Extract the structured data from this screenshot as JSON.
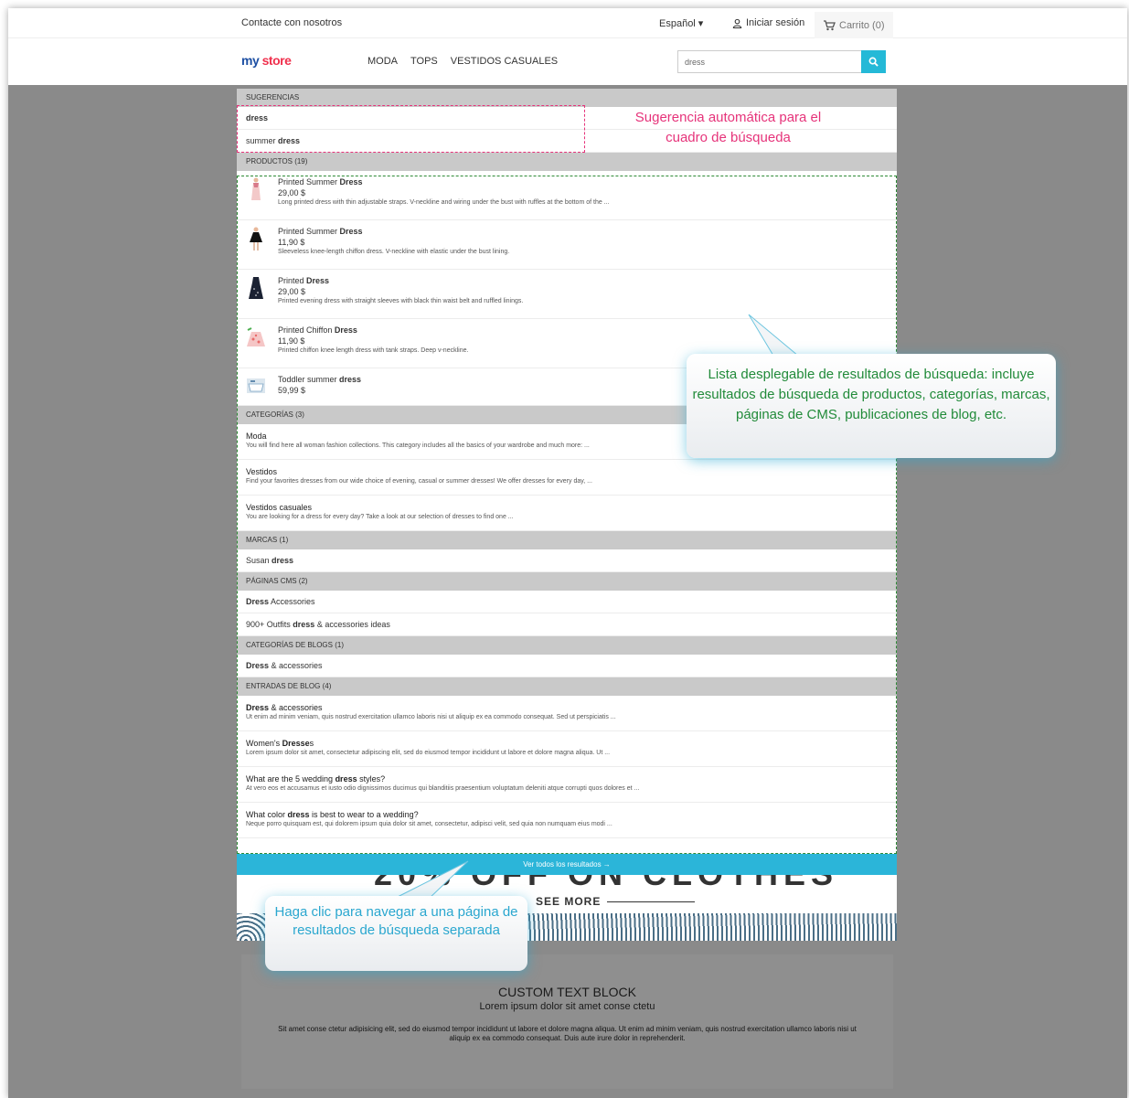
{
  "topbar": {
    "contact": "Contacte con nosotros",
    "language": "Español ▾",
    "login": "Iniciar sesión",
    "cart": "Carrito (0)"
  },
  "header": {
    "logo_part1": "my",
    "logo_part2": "store",
    "nav": [
      "MODA",
      "TOPS",
      "VESTIDOS CASUALES"
    ],
    "search_value": "dress"
  },
  "dropdown": {
    "suggestions_title": "SUGERENCIAS",
    "suggestions": [
      {
        "pre": "",
        "bold": "dress"
      },
      {
        "pre": "summer ",
        "bold": "dress"
      }
    ],
    "products_title": "PRODUCTOS (19)",
    "products": [
      {
        "pre": "Printed Summer ",
        "bold": "Dress",
        "price": "29,00 $",
        "desc": "Long printed dress with thin adjustable straps. V-neckline and wiring under the bust with ruffles at the bottom of the ..."
      },
      {
        "pre": "Printed Summer ",
        "bold": "Dress",
        "price": "11,90 $",
        "desc": "Sleeveless knee-length chiffon dress. V-neckline with elastic under the bust lining."
      },
      {
        "pre": "Printed ",
        "bold": "Dress",
        "price": "29,00 $",
        "desc": "Printed evening dress with straight sleeves with black thin waist belt and ruffled linings."
      },
      {
        "pre": "Printed Chiffon ",
        "bold": "Dress",
        "price": "11,90 $",
        "desc": "Printed chiffon knee length dress with tank straps. Deep v-neckline."
      },
      {
        "pre": "Toddler summer ",
        "bold": "dress",
        "price": "59,99 $",
        "desc": ""
      }
    ],
    "categories_title": "CATEGORÍAS (3)",
    "categories": [
      {
        "name": "Moda",
        "desc": "You will find here all woman fashion collections. This category includes all the basics of your wardrobe and much more: ..."
      },
      {
        "name": "Vestidos",
        "desc": "Find your favorites dresses from our wide choice of evening, casual or summer dresses! We offer dresses for every day, ..."
      },
      {
        "name": "Vestidos casuales",
        "desc": "You are looking for a dress for every day? Take a look at our selection of dresses to find one ..."
      }
    ],
    "brands_title": "MARCAS (1)",
    "brands": [
      {
        "pre": "Susan ",
        "bold": "dress",
        "post": ""
      }
    ],
    "cms_title": "PÁGINAS CMS (2)",
    "cms": [
      {
        "pre": "",
        "bold": "Dress",
        "post": " Accessories"
      },
      {
        "pre": "900+ Outfits ",
        "bold": "dress",
        "post": " & accessories ideas"
      }
    ],
    "blog_categories_title": "CATEGORÍAS DE BLOGS (1)",
    "blog_categories": [
      {
        "pre": "",
        "bold": "Dress",
        "post": " & accessories"
      }
    ],
    "blog_posts_title": "ENTRADAS DE BLOG (4)",
    "blog_posts": [
      {
        "pre": "",
        "bold": "Dress",
        "post": " & accessories",
        "desc": "Ut enim ad minim veniam, quis nostrud exercitation ullamco laboris nisi ut aliquip ex ea commodo consequat. Sed ut perspiciatis ..."
      },
      {
        "pre": "Women's ",
        "bold": "Dresse",
        "post": "s",
        "desc": "Lorem ipsum dolor sit amet, consectetur adipiscing elit, sed do eiusmod tempor incididunt ut labore et dolore magna aliqua. Ut ..."
      },
      {
        "pre": "What are the 5 wedding ",
        "bold": "dress",
        "post": " styles?",
        "desc": "At vero eos et accusamus et iusto odio dignissimos ducimus qui blanditiis praesentium voluptatum deleniti atque corrupti quos dolores et ..."
      },
      {
        "pre": "What color ",
        "bold": "dress",
        "post": " is best to wear to a wedding?",
        "desc": "Neque porro quisquam est, qui dolorem ipsum quia dolor sit amet, consectetur, adipisci velit, sed quia non numquam eius modi ..."
      }
    ],
    "view_all": "Ver todos los resultados →"
  },
  "background": {
    "banner_big": "20% OFF ON CLOTHES",
    "see_more": "SEE MORE",
    "custom_title": "CUSTOM TEXT BLOCK",
    "custom_subtitle": "Lorem ipsum dolor sit amet conse ctetu",
    "custom_text": "Sit amet conse ctetur adipisicing elit, sed do eiusmod tempor incididunt ut labore et dolore magna aliqua. Ut enim ad minim veniam, quis nostrud exercitation ullamco laboris nisi ut aliquip ex ea commodo consequat. Duis aute irure dolor in reprehenderit."
  },
  "annotations": {
    "autosuggest": "Sugerencia automática para el cuadro de búsqueda",
    "dropdown_list": "Lista desplegable de resultados de búsqueda: incluye resultados de búsqueda de productos, categorías, marcas, páginas de CMS, publicaciones de blog, etc.",
    "view_all_hint": "Haga clic para navegar a una página de resultados de búsqueda separada"
  },
  "colors": {
    "accent": "#24b9d7",
    "autosuggest_annotation": "#e6337a",
    "dropdown_annotation": "#228b3a",
    "overlay": "#8a8a8a"
  },
  "icons": [
    "chevron-down-icon",
    "user-icon",
    "cart-icon",
    "search-icon",
    "arrow-right-icon"
  ]
}
